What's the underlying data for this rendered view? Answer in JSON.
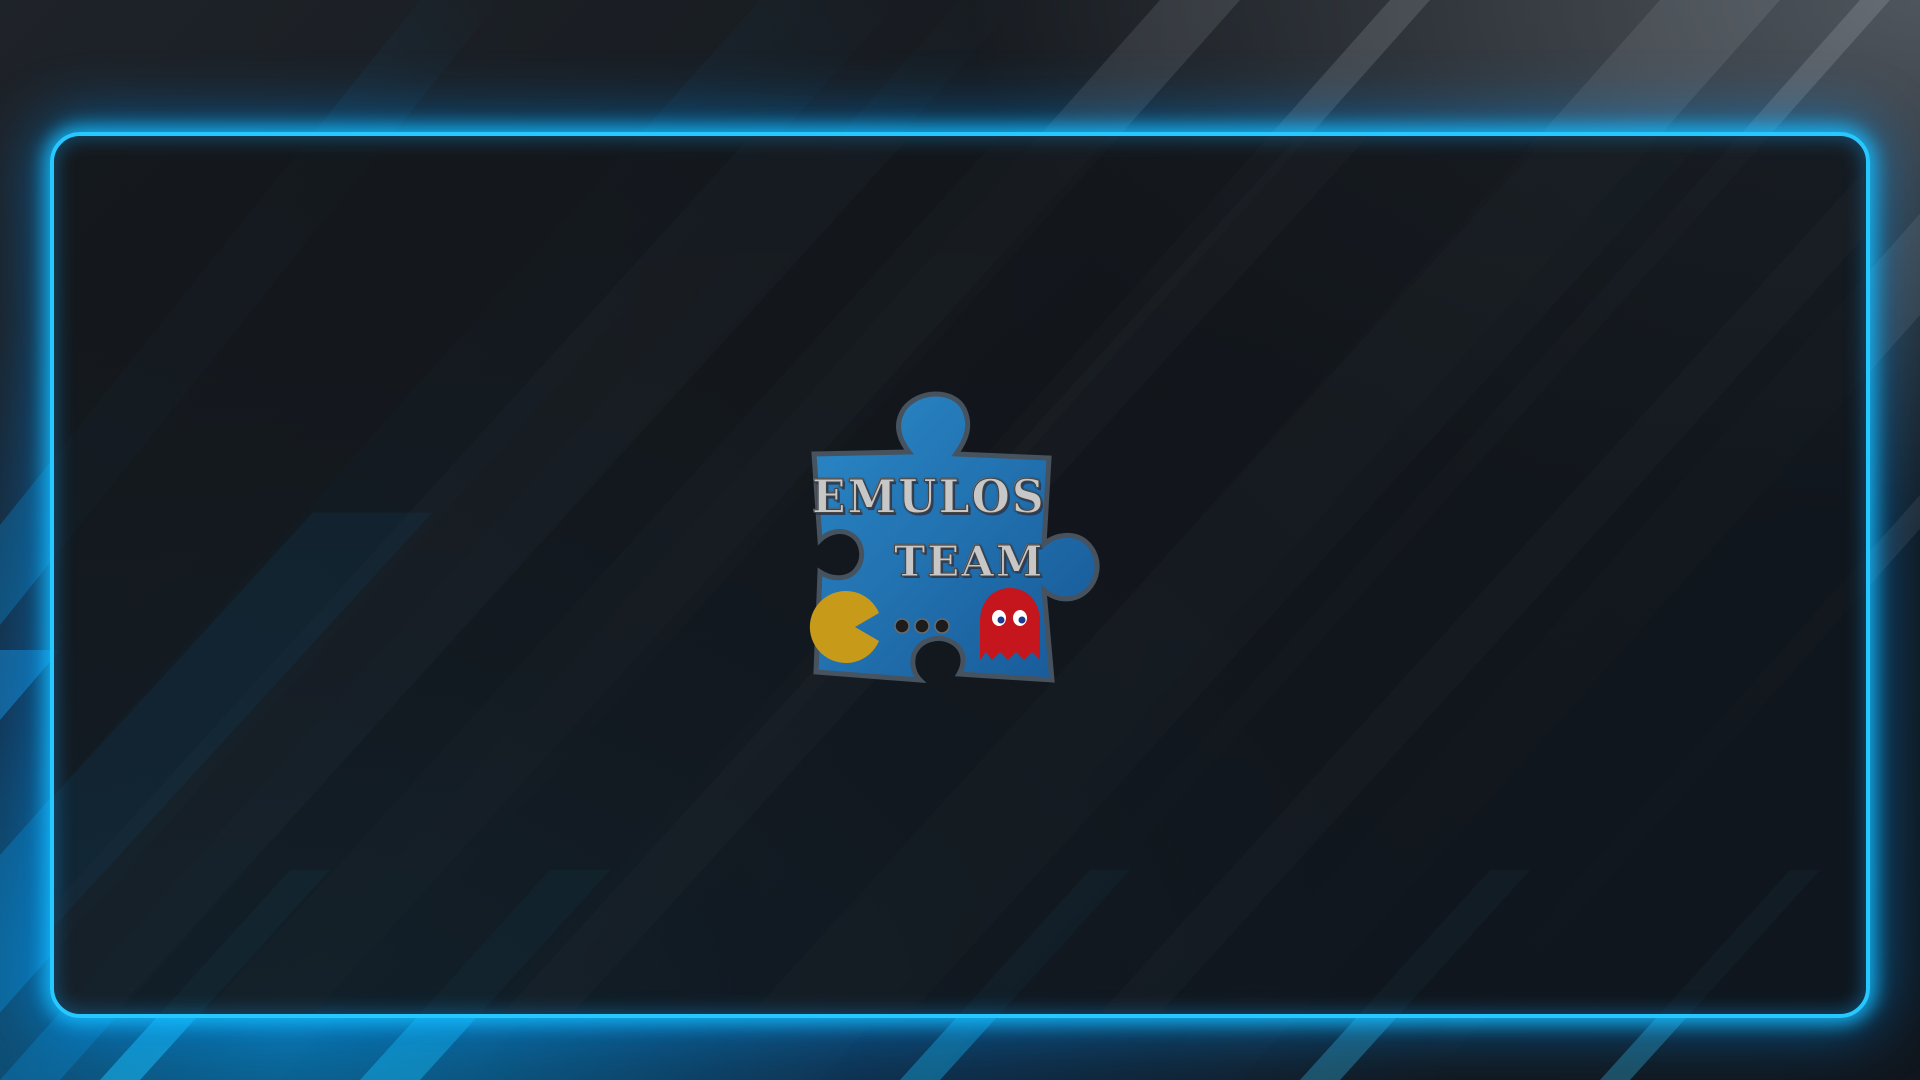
{
  "logo": {
    "name": "puzzle-piece-logo",
    "line_1": "EMULOS",
    "line_2": "TEAM",
    "puzzle_color": "#1f6fb8",
    "pacman_color": "#c79a1a",
    "ghost_color": "#c4161c"
  },
  "theme": {
    "frame_glow": "#27c8ff",
    "background": "#15191e"
  }
}
